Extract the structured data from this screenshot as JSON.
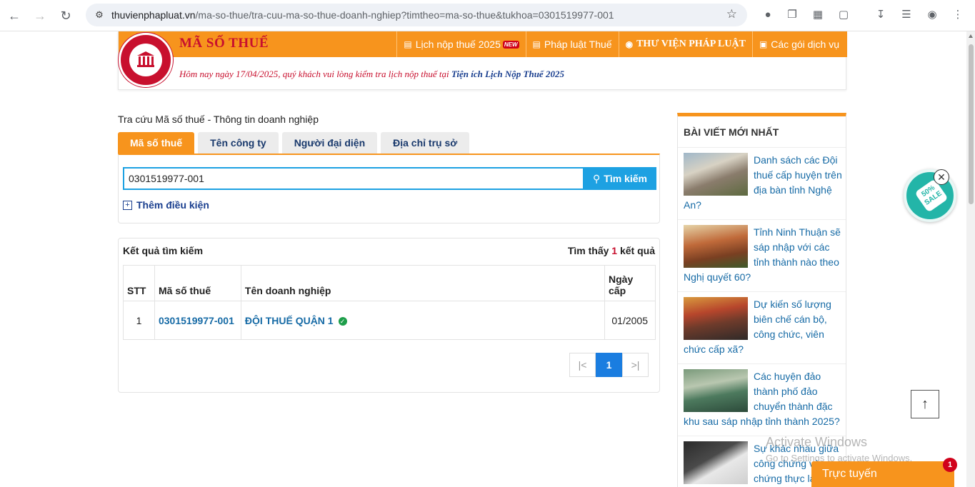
{
  "browser": {
    "url_host": "thuvienphapluat.vn",
    "url_path": "/ma-so-thue/tra-cuu-ma-so-thue-doanh-nghiep?timtheo=ma-so-thue&tukhoa=0301519977-001"
  },
  "header": {
    "site_title": "MÃ SỐ THUẾ",
    "nav": [
      {
        "label": "Lịch nộp thuế 2025",
        "badge": "NEW"
      },
      {
        "label": "Pháp luật Thuế"
      },
      {
        "label": "THƯ VIỆN PHÁP LUẬT"
      },
      {
        "label": "Các gói dịch vụ"
      }
    ],
    "notice_text": "Hôm nay ngày 17/04/2025, quý khách vui lòng kiểm tra lịch nộp thuế tại ",
    "notice_link": "Tiện ích Lịch Nộp Thuế 2025"
  },
  "search": {
    "section_title": "Tra cứu Mã số thuế - Thông tin doanh nghiệp",
    "tabs": [
      "Mã số thuế",
      "Tên công ty",
      "Người đại diện",
      "Địa chỉ trụ sở"
    ],
    "active_tab": 0,
    "input_value": "0301519977-001",
    "button_label": "Tìm kiếm",
    "more_conditions": "Thêm điều kiện"
  },
  "results": {
    "title": "Kết quả tìm kiếm",
    "found_prefix": "Tìm thấy",
    "found_count": "1",
    "found_suffix": "kết quả",
    "columns": [
      "STT",
      "Mã số thuế",
      "Tên doanh nghiệp",
      "Ngày cấp"
    ],
    "rows": [
      {
        "stt": "1",
        "mst": "0301519977-001",
        "name": "ĐỘI THUẾ QUẬN 1",
        "date": "01/2005"
      }
    ],
    "pager": {
      "first": "|<",
      "current": "1",
      "last": ">|"
    }
  },
  "sidebar": {
    "title": "BÀI VIẾT MỚI NHẤT",
    "posts": [
      "Danh sách các Đội thuế cấp huyện trên địa bàn tỉnh Nghệ An?",
      "Tỉnh Ninh Thuận sẽ sáp nhập với các tỉnh thành nào theo Nghị quyết 60?",
      "Dự kiến số lượng biên chế cán bộ, công chức, viên chức cấp xã?",
      "Các huyện đảo thành phố đảo chuyển thành đặc khu sau sáp nhập tỉnh thành 2025?",
      "Sự khác nhau giữa công chứng và chứng thực là gì?"
    ]
  },
  "widgets": {
    "sale_text": "50% SALE",
    "online_label": "Trực tuyến",
    "online_count": "1",
    "watermark_1": "Activate Windows",
    "watermark_2": "Go to Settings to activate Windows."
  }
}
